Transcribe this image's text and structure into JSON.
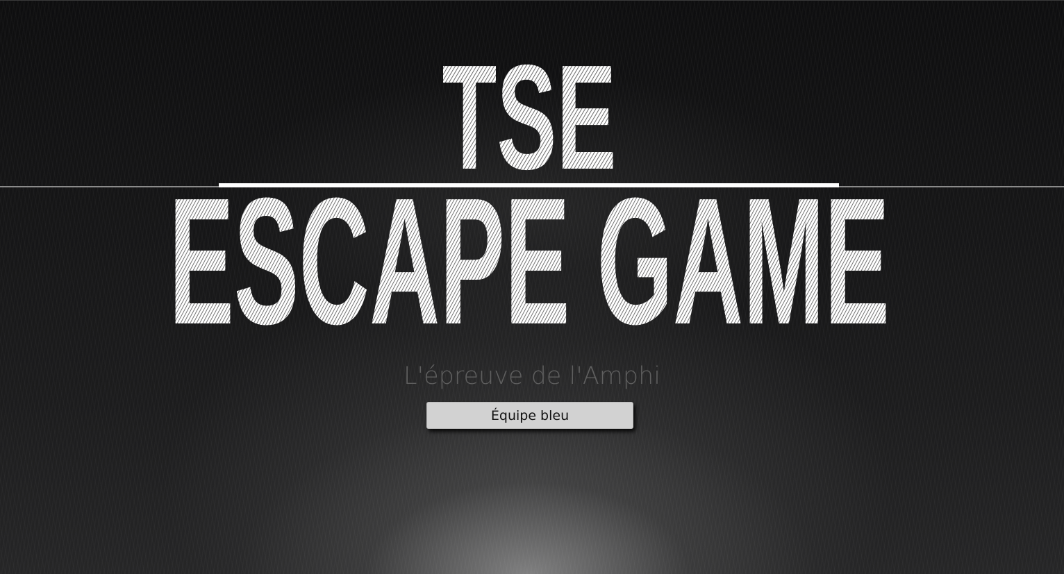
{
  "logo": {
    "line1": "TSE",
    "line2": "ESCAPE GAME"
  },
  "subtitle": "L'épreuve de l'Amphi",
  "team_button": {
    "label": "Équipe bleu"
  },
  "colors": {
    "background": "#111111",
    "logo": "#ffffff",
    "subtitle": "#5f5f5f",
    "button_bg": "#d2d2d2",
    "button_text": "#111111"
  }
}
